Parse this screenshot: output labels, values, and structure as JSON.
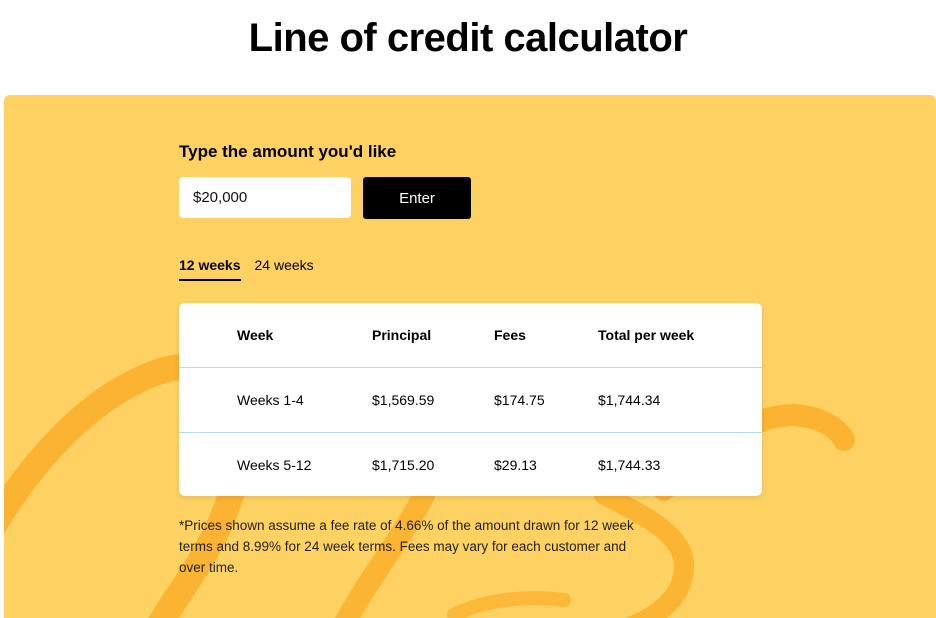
{
  "page": {
    "title": "Line of credit calculator"
  },
  "form": {
    "label": "Type the amount you'd like",
    "amount_value": "$20,000",
    "enter_label": "Enter"
  },
  "tabs": [
    {
      "label": "12 weeks",
      "active": true
    },
    {
      "label": "24 weeks",
      "active": false
    }
  ],
  "table": {
    "headers": [
      "Week",
      "Principal",
      "Fees",
      "Total per week"
    ],
    "rows": [
      [
        "Weeks 1-4",
        "$1,569.59",
        "$174.75",
        "$1,744.34"
      ],
      [
        "Weeks 5-12",
        "$1,715.20",
        "$29.13",
        "$1,744.33"
      ]
    ]
  },
  "footnote": "*Prices shown assume a fee rate of 4.66% of the amount drawn for 12 week terms and 8.99% for 24 week terms. Fees may vary for each customer and over time.",
  "colors": {
    "panel": "#fdd263",
    "swirl": "#fbb12e",
    "button": "#000000",
    "divider": "#b6dbe9"
  }
}
